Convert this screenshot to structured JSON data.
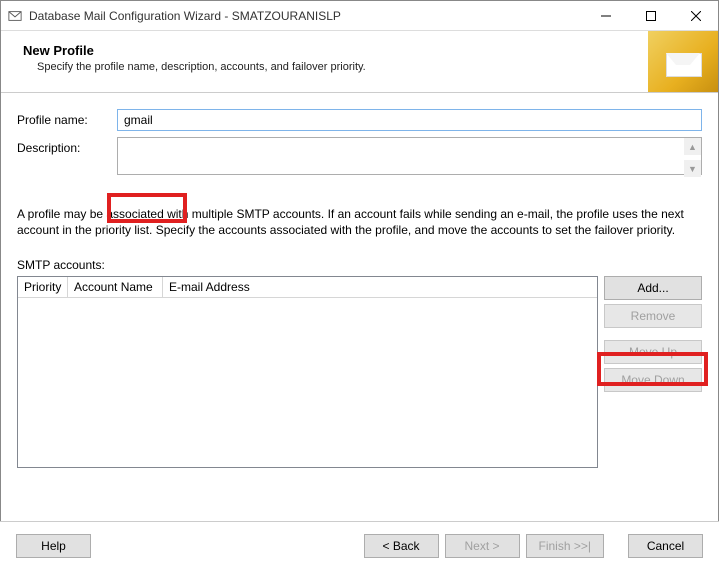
{
  "window": {
    "title": "Database Mail Configuration Wizard - SMATZOURANISLP"
  },
  "header": {
    "title": "New Profile",
    "subtitle": "Specify the profile name, description, accounts, and failover priority."
  },
  "form": {
    "profile_label": "Profile name:",
    "profile_value": "gmail",
    "description_label": "Description:",
    "description_value": ""
  },
  "info_text": "A profile may be associated with multiple SMTP accounts. If an account fails while sending an e-mail, the profile uses the next account in the priority list. Specify the accounts associated with the profile, and move the accounts to set the failover priority.",
  "smtp": {
    "label": "SMTP accounts:",
    "columns": {
      "priority": "Priority",
      "account_name": "Account Name",
      "email": "E-mail Address"
    },
    "rows": []
  },
  "side_buttons": {
    "add": "Add...",
    "remove": "Remove",
    "move_up": "Move Up",
    "move_down": "Move Down"
  },
  "footer": {
    "help": "Help",
    "back": "< Back",
    "next": "Next >",
    "finish": "Finish >>|",
    "cancel": "Cancel"
  }
}
